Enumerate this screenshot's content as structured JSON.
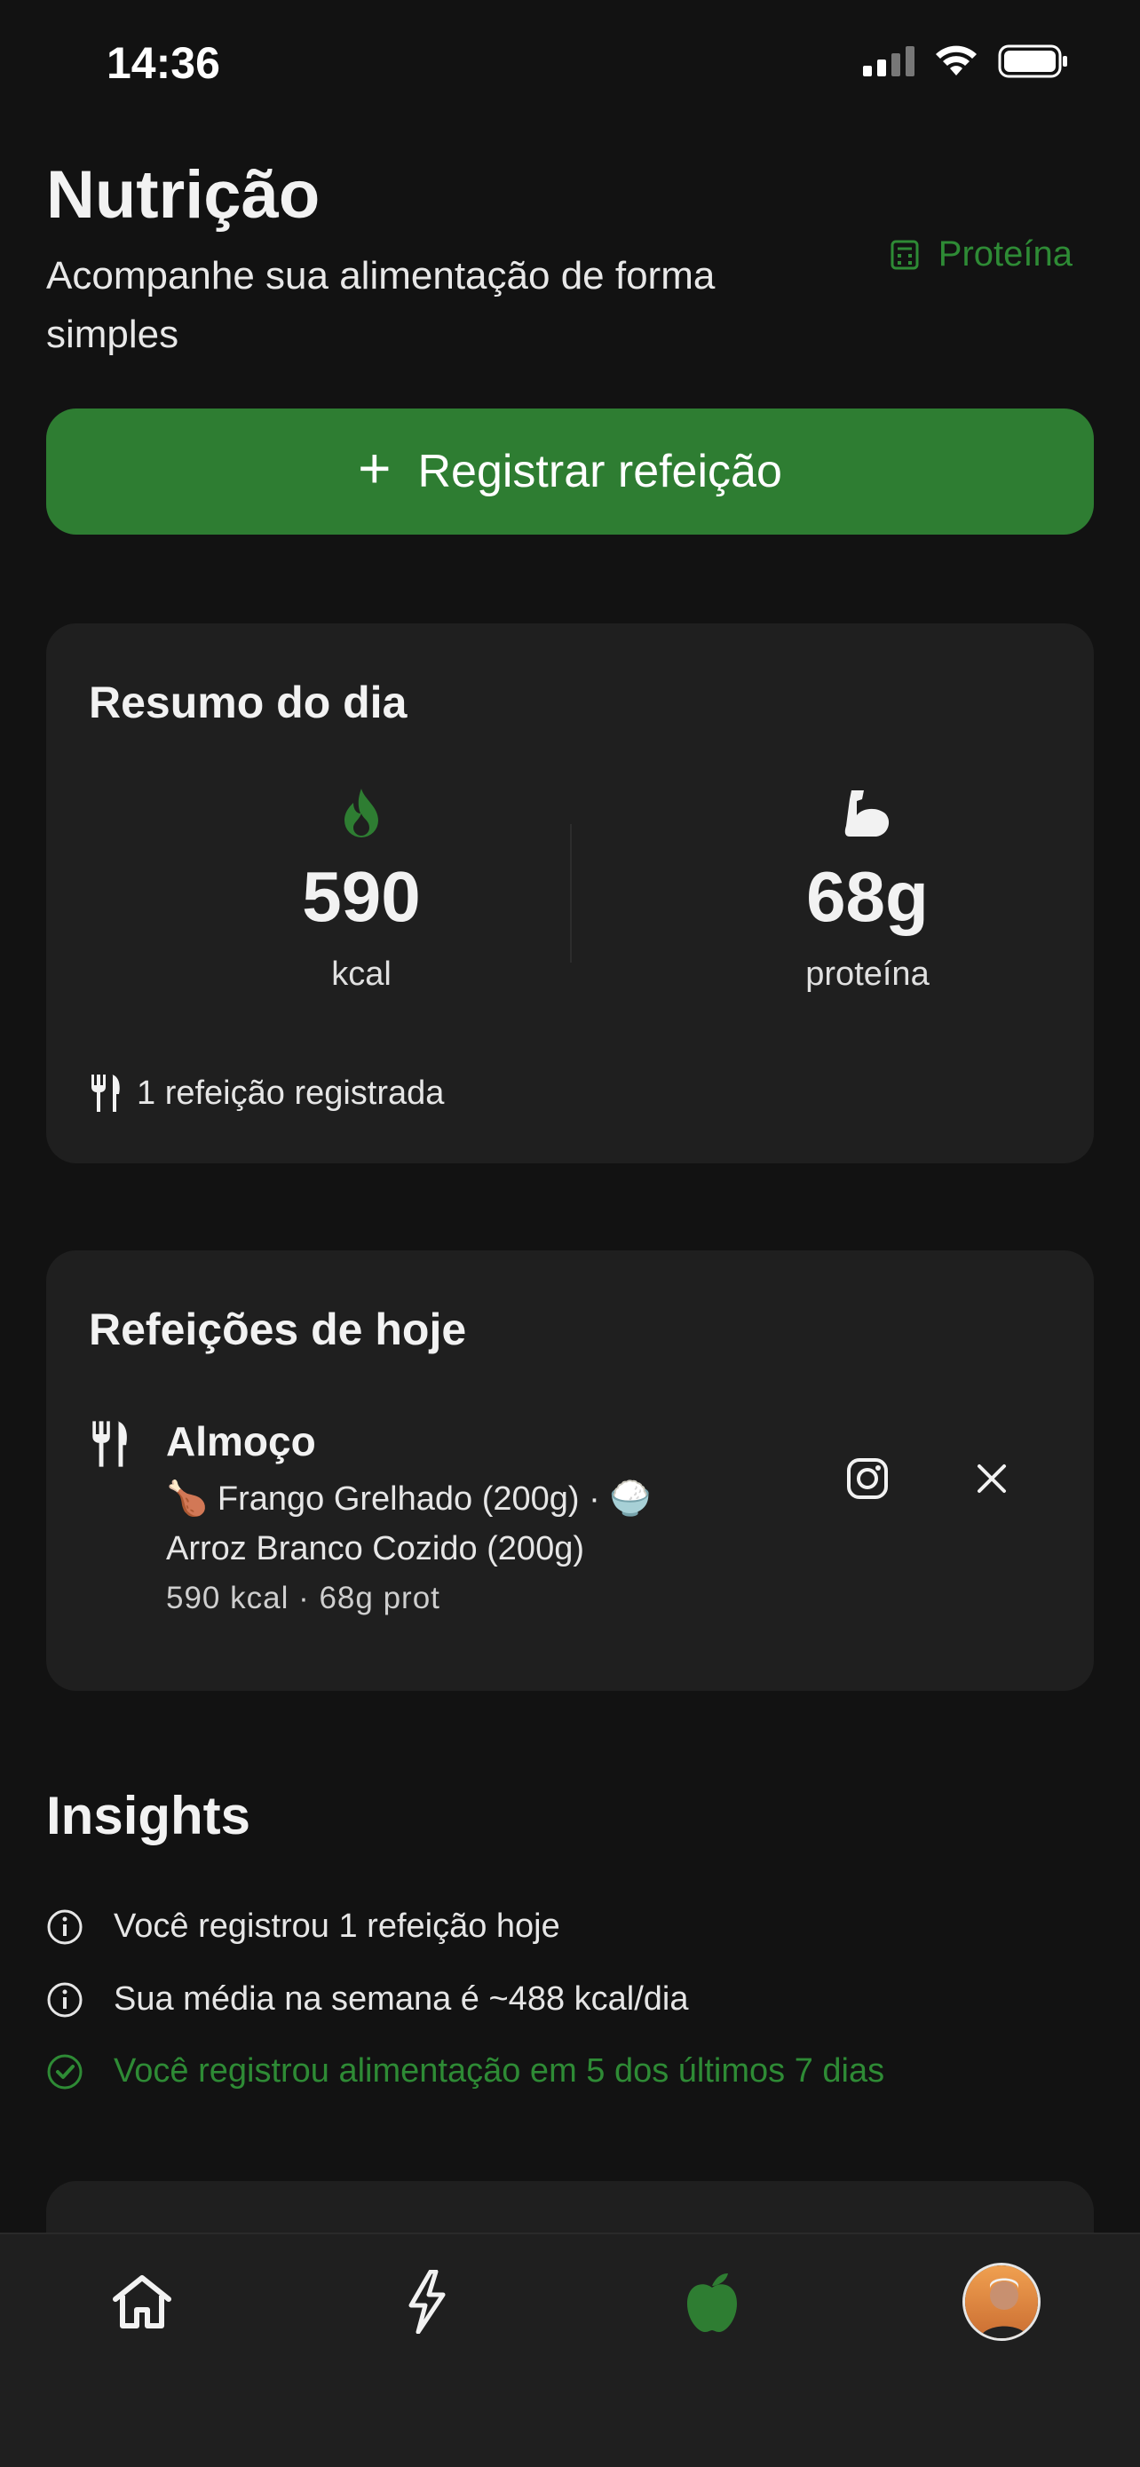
{
  "status_bar": {
    "time": "14:36"
  },
  "header": {
    "title": "Nutrição",
    "subtitle": "Acompanhe sua alimentação de forma simples",
    "protein_link": "Proteína"
  },
  "register_button": {
    "label": "Registrar refeição",
    "icon": "plus-icon"
  },
  "summary": {
    "title": "Resumo do dia",
    "calories": {
      "value": "590",
      "label": "kcal",
      "icon": "flame-icon"
    },
    "protein": {
      "value": "68g",
      "label": "proteína",
      "icon": "flexed-arm-icon"
    },
    "footer": "1 refeição registrada"
  },
  "meals": {
    "title": "Refeições de hoje",
    "items": [
      {
        "name": "Almoço",
        "foods_line1": "🍗 Frango Grelhado (200g)  ·  🍚",
        "foods_line2": "Arroz Branco Cozido (200g)",
        "totals": "590 kcal · 68g prot"
      }
    ]
  },
  "insights": {
    "title": "Insights",
    "items": [
      {
        "text": "Você registrou 1 refeição hoje",
        "icon": "info-icon"
      },
      {
        "text": "Sua média na semana é ~488 kcal/dia",
        "icon": "info-icon"
      },
      {
        "text": "Você registrou alimentação em 5 dos últimos 7 dias",
        "icon": "check-circle-icon"
      }
    ]
  },
  "colors": {
    "background": "#121212",
    "card": "#1f1f1f",
    "accent_green": "#2e7d32",
    "text_green": "#2e8b35"
  },
  "bottom_nav": [
    "home-icon",
    "lightning-icon",
    "apple-icon",
    "avatar"
  ]
}
